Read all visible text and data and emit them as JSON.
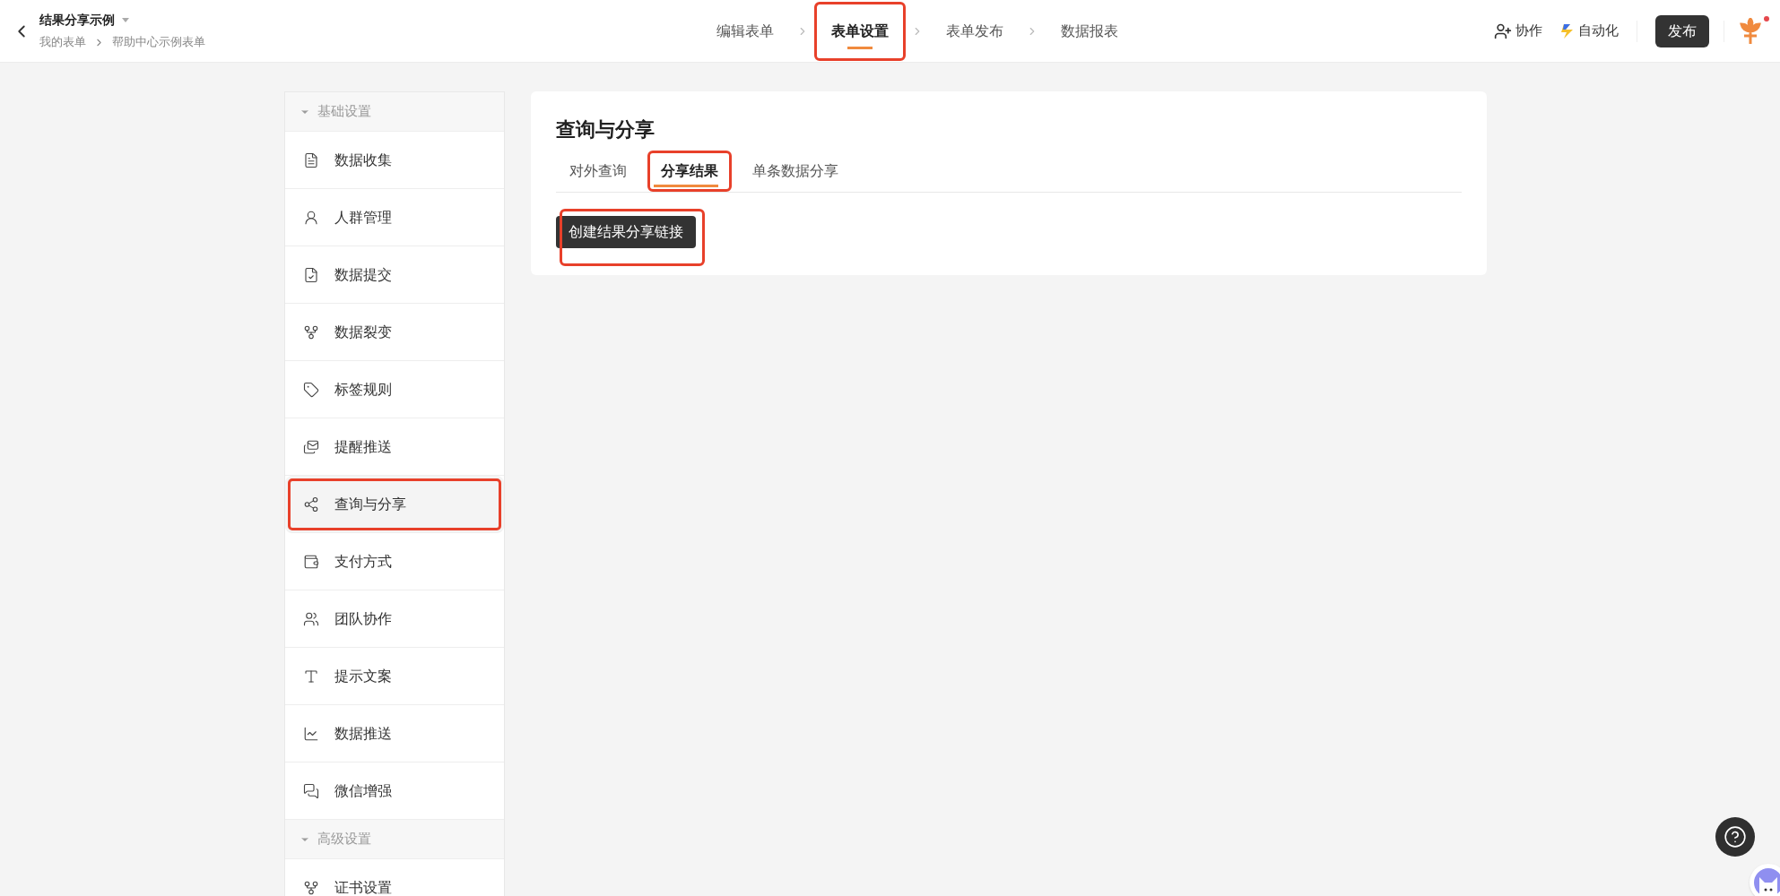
{
  "header": {
    "title": "结果分享示例",
    "breadcrumb": [
      "我的表单",
      "帮助中心示例表单"
    ],
    "steps": [
      {
        "label": "编辑表单",
        "selected": false,
        "annotated": false
      },
      {
        "label": "表单设置",
        "selected": true,
        "annotated": true
      },
      {
        "label": "表单发布",
        "selected": false,
        "annotated": false
      },
      {
        "label": "数据报表",
        "selected": false,
        "annotated": false
      }
    ],
    "collaborate": "协作",
    "automate": "自动化",
    "publish": "发布",
    "notification_dot": true
  },
  "sidebar": {
    "groups": [
      {
        "title": "基础设置",
        "expanded": true,
        "items": [
          {
            "label": "数据收集",
            "selected": false,
            "annotated": false
          },
          {
            "label": "人群管理",
            "selected": false,
            "annotated": false
          },
          {
            "label": "数据提交",
            "selected": false,
            "annotated": false
          },
          {
            "label": "数据裂变",
            "selected": false,
            "annotated": false
          },
          {
            "label": "标签规则",
            "selected": false,
            "annotated": false
          },
          {
            "label": "提醒推送",
            "selected": false,
            "annotated": false
          },
          {
            "label": "查询与分享",
            "selected": true,
            "annotated": true
          },
          {
            "label": "支付方式",
            "selected": false,
            "annotated": false
          },
          {
            "label": "团队协作",
            "selected": false,
            "annotated": false
          },
          {
            "label": "提示文案",
            "selected": false,
            "annotated": false
          },
          {
            "label": "数据推送",
            "selected": false,
            "annotated": false
          },
          {
            "label": "微信增强",
            "selected": false,
            "annotated": false
          }
        ]
      },
      {
        "title": "高级设置",
        "expanded": true,
        "items": [
          {
            "label": "证书设置",
            "selected": false,
            "annotated": false
          }
        ]
      }
    ]
  },
  "main": {
    "title": "查询与分享",
    "tabs": [
      {
        "label": "对外查询",
        "selected": false,
        "annotated": false
      },
      {
        "label": "分享结果",
        "selected": true,
        "annotated": true
      },
      {
        "label": "单条数据分享",
        "selected": false,
        "annotated": false
      }
    ],
    "button": {
      "label": "创建结果分享链接",
      "annotated": true
    }
  }
}
